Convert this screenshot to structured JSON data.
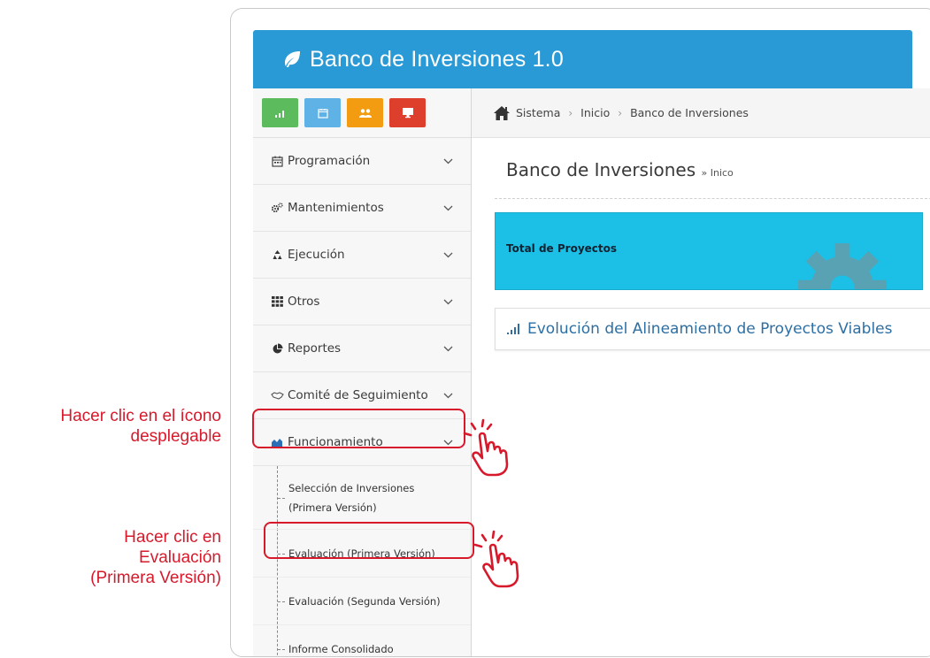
{
  "annotations": {
    "step1": [
      "Hacer clic en el ícono",
      "desplegable"
    ],
    "step2": [
      "Hacer clic en",
      "Evaluación",
      "(Primera Versión)"
    ]
  },
  "app": {
    "title": "Banco de Inversiones 1.0",
    "header_color": "#2a9ad6",
    "logo_icon": "leaf-icon"
  },
  "shortcuts": [
    {
      "name": "stats",
      "icon": "bar-chart-icon",
      "color": "#5cbb5c"
    },
    {
      "name": "calendar",
      "icon": "calendar-icon",
      "color": "#5fb2e6"
    },
    {
      "name": "users",
      "icon": "users-icon",
      "color": "#f39c12"
    },
    {
      "name": "monitor",
      "icon": "monitor-icon",
      "color": "#de3f2d"
    }
  ],
  "sidebar": {
    "items": [
      {
        "label": "Programación",
        "icon": "calendar-icon"
      },
      {
        "label": "Mantenimientos",
        "icon": "cogs-icon"
      },
      {
        "label": "Ejecución",
        "icon": "recycle-icon"
      },
      {
        "label": "Otros",
        "icon": "grid-icon"
      },
      {
        "label": "Reportes",
        "icon": "pie-chart-icon"
      },
      {
        "label": "Comité de Seguimiento",
        "icon": "handshake-icon"
      },
      {
        "label": "Funcionamiento",
        "icon": "area-chart-icon"
      }
    ],
    "subitems": [
      {
        "label": "Selección de Inversiones",
        "label2": "(Primera Versión)"
      },
      {
        "label": "Evaluación (Primera Versión)"
      },
      {
        "label": "Evaluación (Segunda Versión)"
      },
      {
        "label": "Informe Consolidado"
      }
    ]
  },
  "breadcrumb": {
    "items": [
      "Sistema",
      "Inicio",
      "Banco de Inversiones"
    ],
    "separator": "›"
  },
  "main": {
    "title": "Banco de Inversiones",
    "title_sub": "» Inico",
    "stat_label": "Total de Proyectos",
    "stat_color": "#1cc0e6",
    "panel_title": "Evolución del Alineamiento de Proyectos Viables"
  },
  "accent_red": "#d7192b"
}
